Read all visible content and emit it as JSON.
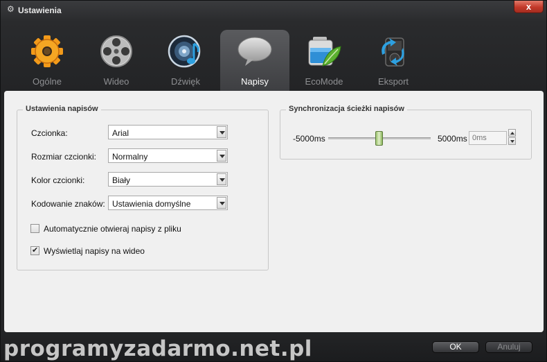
{
  "window": {
    "title": "Ustawienia",
    "close_label": "x"
  },
  "tabs": [
    {
      "label": "Ogólne",
      "icon": "gear-icon",
      "active": false
    },
    {
      "label": "Wideo",
      "icon": "film-reel-icon",
      "active": false
    },
    {
      "label": "Dźwięk",
      "icon": "speaker-note-icon",
      "active": false
    },
    {
      "label": "Napisy",
      "icon": "speech-bubble-icon",
      "active": true
    },
    {
      "label": "EcoMode",
      "icon": "battery-leaf-icon",
      "active": false
    },
    {
      "label": "Eksport",
      "icon": "device-export-icon",
      "active": false
    }
  ],
  "subtitles_group": {
    "legend": "Ustawienia napisów",
    "font_label": "Czcionka:",
    "font_value": "Arial",
    "size_label": "Rozmiar czcionki:",
    "size_value": "Normalny",
    "color_label": "Kolor czcionki:",
    "color_value": "Biały",
    "encoding_label": "Kodowanie znaków:",
    "encoding_value": "Ustawienia domyślne",
    "auto_open_label": "Automatycznie otwieraj napisy z pliku",
    "auto_open_checked": false,
    "show_label": "Wyświetlaj napisy na wideo",
    "show_checked": true
  },
  "sync_group": {
    "legend": "Synchronizacja ścieżki napisów",
    "min_label": "-5000ms",
    "max_label": "5000ms",
    "value_placeholder": "0ms",
    "slider_value_ms": 0
  },
  "footer": {
    "watermark": "programyzadarmo.net.pl",
    "ok_label": "OK",
    "cancel_label": "Anuluj"
  },
  "colors": {
    "accent_green": "#8bb65b",
    "close_red": "#c2392a",
    "panel_bg": "#f0f0f0"
  }
}
